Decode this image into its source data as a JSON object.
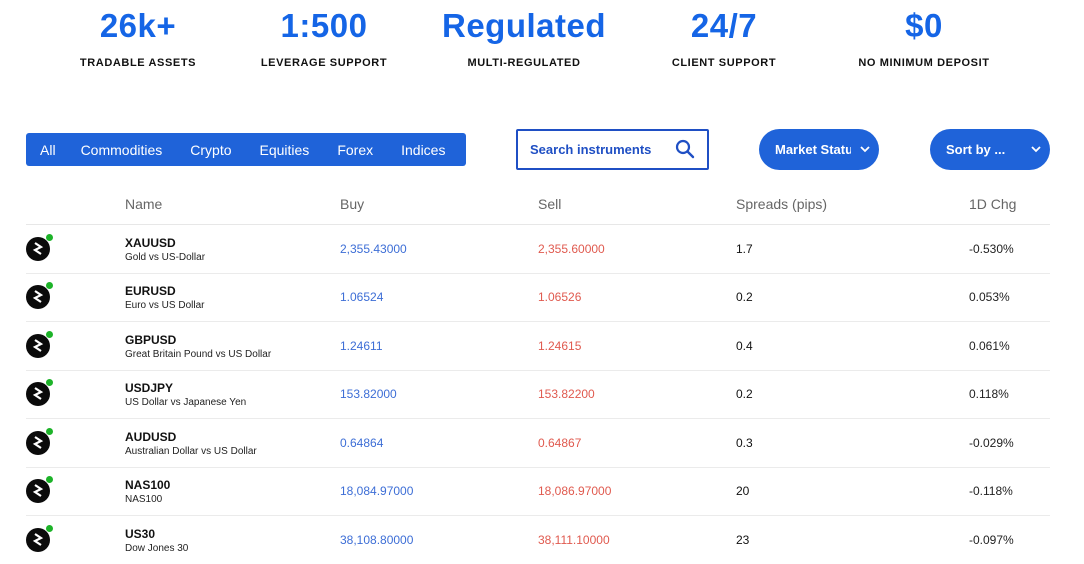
{
  "stats": [
    {
      "value": "26k+",
      "label": "TRADABLE ASSETS"
    },
    {
      "value": "1:500",
      "label": "LEVERAGE SUPPORT"
    },
    {
      "value": "Regulated",
      "label": "MULTI-REGULATED"
    },
    {
      "value": "24/7",
      "label": "CLIENT SUPPORT"
    },
    {
      "value": "$0",
      "label": "NO MINIMUM DEPOSIT"
    }
  ],
  "tabs": [
    "All",
    "Commodities",
    "Crypto",
    "Equities",
    "Forex",
    "Indices"
  ],
  "search": {
    "placeholder": "Search instruments"
  },
  "filters": {
    "market_status": "Market Status",
    "sort_by": "Sort by ..."
  },
  "table": {
    "headers": {
      "name": "Name",
      "buy": "Buy",
      "sell": "Sell",
      "spread": "Spreads (pips)",
      "change": "1D Chg"
    },
    "rows": [
      {
        "symbol": "XAUUSD",
        "description": "Gold vs US-Dollar",
        "buy": "2,355.43000",
        "sell": "2,355.60000",
        "spread": "1.7",
        "change": "-0.530%"
      },
      {
        "symbol": "EURUSD",
        "description": "Euro vs US Dollar",
        "buy": "1.06524",
        "sell": "1.06526",
        "spread": "0.2",
        "change": "0.053%"
      },
      {
        "symbol": "GBPUSD",
        "description": "Great Britain Pound vs US Dollar",
        "buy": "1.24611",
        "sell": "1.24615",
        "spread": "0.4",
        "change": "0.061%"
      },
      {
        "symbol": "USDJPY",
        "description": "US Dollar vs Japanese Yen",
        "buy": "153.82000",
        "sell": "153.82200",
        "spread": "0.2",
        "change": "0.118%"
      },
      {
        "symbol": "AUDUSD",
        "description": "Australian Dollar vs US Dollar",
        "buy": "0.64864",
        "sell": "0.64867",
        "spread": "0.3",
        "change": "-0.029%"
      },
      {
        "symbol": "NAS100",
        "description": "NAS100",
        "buy": "18,084.97000",
        "sell": "18,086.97000",
        "spread": "20",
        "change": "-0.118%"
      },
      {
        "symbol": "US30",
        "description": "Dow Jones 30",
        "buy": "38,108.80000",
        "sell": "38,111.10000",
        "spread": "23",
        "change": "-0.097%"
      }
    ]
  },
  "colors": {
    "brand_blue": "#1f63d9",
    "stat_blue": "#1565e6",
    "buy_blue": "#3d6ed6",
    "sell_red": "#e05a4f",
    "status_green": "#1db329"
  }
}
